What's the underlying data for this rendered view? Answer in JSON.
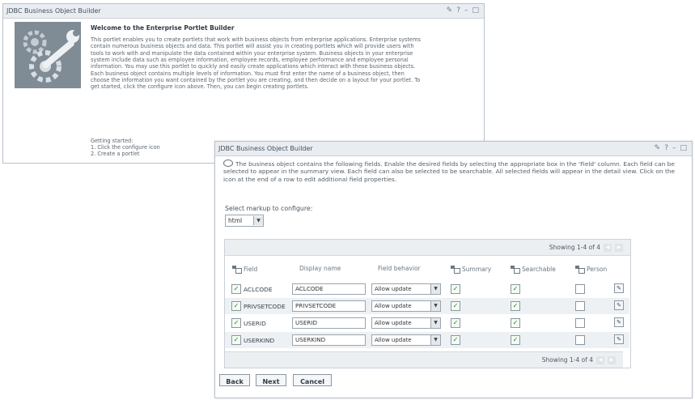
{
  "portlet1": {
    "title": "JDBC Business Object Builder",
    "window_icons": [
      "✎",
      "?",
      "–",
      "□"
    ],
    "heading": "Welcome to the Enterprise Portlet Builder",
    "body": "This portlet enables you to create portlets that work with business objects from enterprise applications. Enterprise systems contain numerous business objects and data. This portlet will assist you in creating portlets which will provide users with tools to work with and manipulate the data contained within your enterprise system. Business objects in your enterprise system include data such as employee information, employee records, employee performance and employee personal information. You may use this portlet to quickly and easily create applications which interact with these business objects. Each business object contains multiple levels of information. You must first enter the name of a business object, then choose the information you want contained by the portlet you are creating, and then decide on a layout for your portlet. To get started, click the configure icon above. Then, you can begin creating portlets.",
    "getting_started_title": "Getting started:",
    "steps": [
      "1. Click the configure icon",
      "2. Create a portlet"
    ]
  },
  "portlet2": {
    "title": "JDBC Business Object Builder",
    "window_icons": [
      "✎",
      "?",
      "–",
      "□"
    ],
    "intro": "The business object contains the following fields. Enable the desired fields by selecting the appropriate box in the 'Field' column. Each field can be selected to appear in the summary view. Each field can also be selected to be searchable. All selected fields will appear in the detail view. Click on the icon at the end of a row to edit additional field properties.",
    "markup_label": "Select markup to configure:",
    "markup_value": "html",
    "paging_top": "Showing 1-4 of 4",
    "paging_bottom": "Showing 1-4 of 4",
    "columns": {
      "field": "Field",
      "display_name": "Display name",
      "behavior": "Field behavior",
      "summary": "Summary",
      "searchable": "Searchable",
      "person": "Person"
    },
    "rows": [
      {
        "field": "ACLCODE",
        "display": "ACLCODE",
        "behavior": "Allow update",
        "enabled": true,
        "summary": true,
        "searchable": true,
        "person": false
      },
      {
        "field": "PRIVSETCODE",
        "display": "PRIVSETCODE",
        "behavior": "Allow update",
        "enabled": true,
        "summary": true,
        "searchable": true,
        "person": false
      },
      {
        "field": "USERID",
        "display": "USERID",
        "behavior": "Allow update",
        "enabled": true,
        "summary": true,
        "searchable": true,
        "person": false
      },
      {
        "field": "USERKIND",
        "display": "USERKIND",
        "behavior": "Allow update",
        "enabled": true,
        "summary": true,
        "searchable": true,
        "person": false
      }
    ],
    "buttons": {
      "back": "Back",
      "next": "Next",
      "cancel": "Cancel"
    }
  }
}
